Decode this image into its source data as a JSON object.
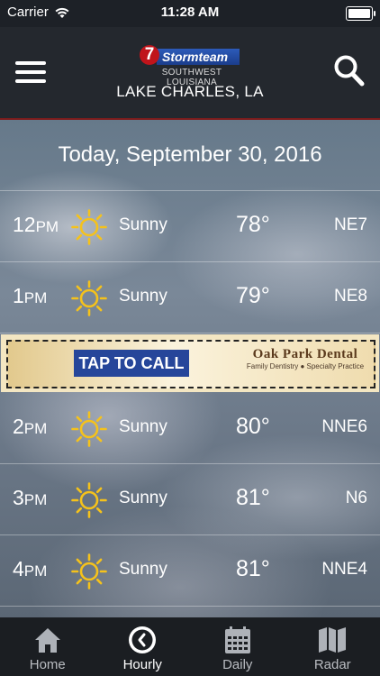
{
  "status_bar": {
    "carrier": "Carrier",
    "time": "11:28 AM"
  },
  "header": {
    "logo_badge": "7",
    "logo_name": "Stormteam",
    "logo_sub": "SOUTHWEST LOUISIANA",
    "location": "LAKE CHARLES, LA"
  },
  "date_label": "Today, September 30, 2016",
  "hours": [
    {
      "hour": "12",
      "ampm": "PM",
      "condition": "Sunny",
      "temp": "78°",
      "wind": "NE7",
      "icon": "sun-icon"
    },
    {
      "hour": "1",
      "ampm": "PM",
      "condition": "Sunny",
      "temp": "79°",
      "wind": "NE8",
      "icon": "sun-icon"
    },
    {
      "hour": "2",
      "ampm": "PM",
      "condition": "Sunny",
      "temp": "80°",
      "wind": "NNE6",
      "icon": "sun-icon"
    },
    {
      "hour": "3",
      "ampm": "PM",
      "condition": "Sunny",
      "temp": "81°",
      "wind": "N6",
      "icon": "sun-icon"
    },
    {
      "hour": "4",
      "ampm": "PM",
      "condition": "Sunny",
      "temp": "81°",
      "wind": "NNE4",
      "icon": "sun-icon"
    }
  ],
  "ad": {
    "button": "TAP TO CALL",
    "brand": "Oak Park Dental",
    "tagline": "Family Dentistry ● Specialty Practice"
  },
  "tabs": [
    {
      "label": "Home",
      "icon": "home-icon",
      "active": false
    },
    {
      "label": "Hourly",
      "icon": "clock-icon",
      "active": true
    },
    {
      "label": "Daily",
      "icon": "calendar-icon",
      "active": false
    },
    {
      "label": "Radar",
      "icon": "map-icon",
      "active": false
    }
  ],
  "colors": {
    "accent_line": "#7d1d1d",
    "sun": "#f5c21b",
    "ad_button": "#26469a"
  }
}
